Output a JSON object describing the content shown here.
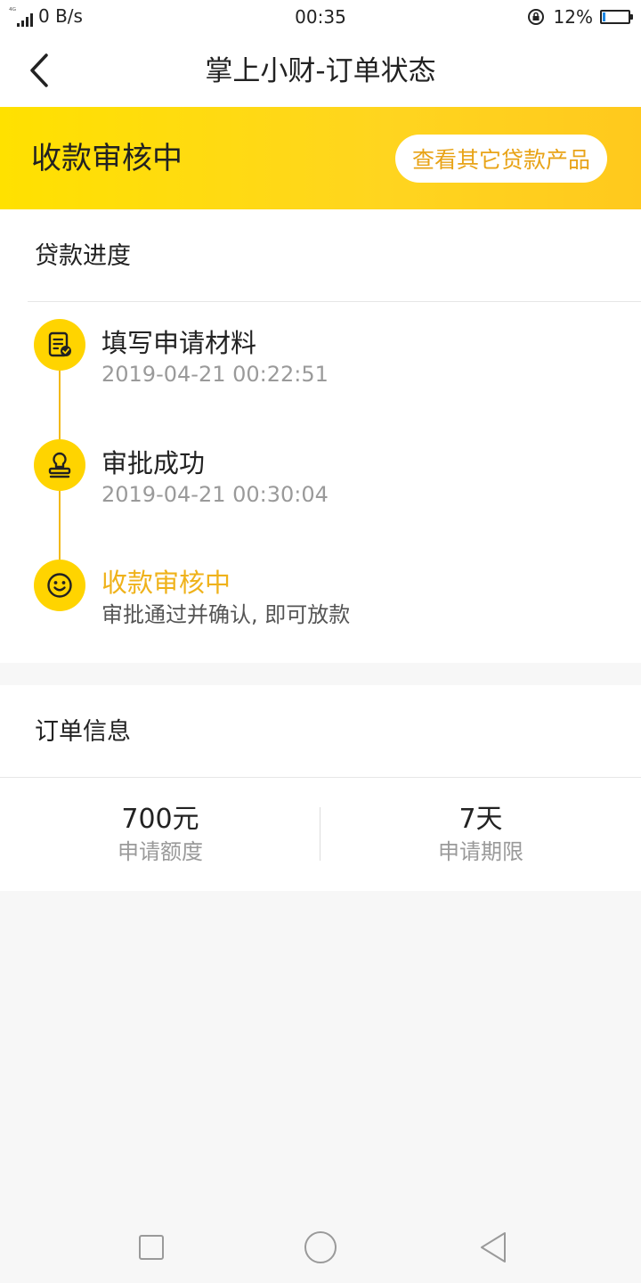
{
  "status_bar": {
    "network_tiny": "⁴ᴳ",
    "network_type": "4G",
    "speed": "0 B/s",
    "time": "00:35",
    "battery_percent": "12%",
    "battery_level": 0.12,
    "battery_color": "#1e88e5"
  },
  "nav": {
    "back_icon": "chevron-left-icon",
    "title": "掌上小财-订单状态"
  },
  "banner": {
    "status": "收款审核中",
    "button_label": "查看其它贷款产品",
    "gradient_colors": [
      "#ffe100",
      "#ffc91d"
    ]
  },
  "progress": {
    "title": "贷款进度",
    "steps": [
      {
        "icon": "document-check-icon",
        "title": "填写申请材料",
        "subtitle": "2019-04-21 00:22:51",
        "active": false
      },
      {
        "icon": "stamp-icon",
        "title": "审批成功",
        "subtitle": "2019-04-21 00:30:04",
        "active": false
      },
      {
        "icon": "smiley-icon",
        "title": "收款审核中",
        "subtitle": "审批通过并确认, 即可放款",
        "active": true
      }
    ]
  },
  "order": {
    "title": "订单信息",
    "stats": [
      {
        "value": "700元",
        "label": "申请额度"
      },
      {
        "value": "7天",
        "label": "申请期限"
      }
    ]
  },
  "colors": {
    "accent": "#ffd400",
    "active_text": "#efb21a",
    "timeline": "#f3b91a"
  }
}
